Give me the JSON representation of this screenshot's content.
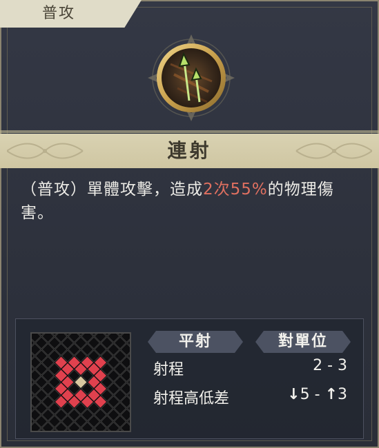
{
  "category": {
    "label": "普攻"
  },
  "skill": {
    "name": "連射",
    "icon": "double-arrow-icon",
    "description": {
      "prefix": "（普攻）單體攻擊，造成",
      "hits": "2次",
      "percent": "55%",
      "suffix": "的物理傷害。"
    }
  },
  "range_info": {
    "shape_label": "平射",
    "target_label": "對單位",
    "range_label": "射程",
    "range_value": "2 - 3",
    "height_label": "射程高低差",
    "height_down": "5",
    "height_separator": "-",
    "height_up": "3"
  },
  "range_grid": {
    "colors": {
      "attack": "#e0414e",
      "origin": "#d8c8a0",
      "empty": "#0e0e10"
    },
    "attack_cells": [
      [
        -3,
        0
      ],
      [
        3,
        0
      ],
      [
        0,
        -3
      ],
      [
        0,
        3
      ],
      [
        -2,
        -1
      ],
      [
        -2,
        1
      ],
      [
        2,
        -1
      ],
      [
        2,
        1
      ],
      [
        -1,
        -2
      ],
      [
        -1,
        2
      ],
      [
        1,
        -2
      ],
      [
        1,
        2
      ],
      [
        -2,
        0
      ],
      [
        2,
        0
      ],
      [
        0,
        -2
      ],
      [
        0,
        2
      ],
      [
        -1,
        -1
      ],
      [
        -1,
        1
      ],
      [
        1,
        -1
      ],
      [
        1,
        1
      ]
    ]
  },
  "colors": {
    "highlight": "#e07060",
    "title_bar": "#d9d2b2",
    "icon_ring": "#d7b35a"
  }
}
